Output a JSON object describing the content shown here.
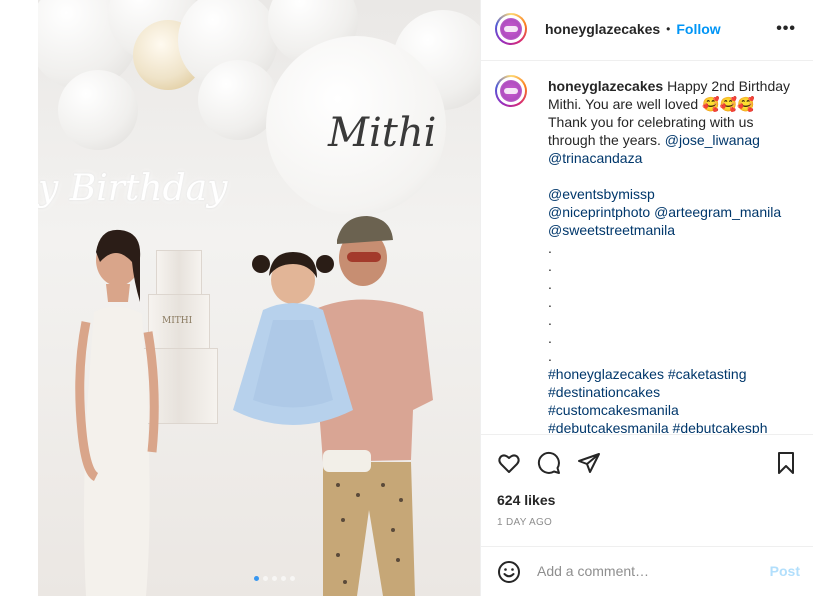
{
  "post": {
    "username": "honeyglazecakes",
    "separator": "•",
    "follow_label": "Follow",
    "more_label": "•••",
    "caption": {
      "username": "honeyglazecakes",
      "line1_text": "Happy 2nd Birthday",
      "line2_text": "Mithi. You are well loved 🥰🥰🥰",
      "line3_text": "Thank you for celebrating with us",
      "line4_text": "through the years.",
      "mention_jose": "@jose_liwanag",
      "mention_trina": "@trinacandaza",
      "mention_events": "@eventsbymissp",
      "mention_niceprint": "@niceprintphoto",
      "mention_arteegram": "@arteegram_manila",
      "mention_sweetstreet": "@sweetstreetmanila",
      "dots": [
        ".",
        ".",
        ".",
        ".",
        ".",
        ".",
        "."
      ],
      "tag_honeyglaze": "#honeyglazecakes",
      "tag_caketasting": "#caketasting",
      "tag_destination": "#destinationcakes",
      "tag_custom": "#customcakesmanila",
      "tag_debut_manila": "#debutcakesmanila",
      "tag_debut_ph": "#debutcakesph"
    },
    "likes": "624 likes",
    "timestamp": "1 DAY AGO",
    "comment_placeholder": "Add a comment…",
    "post_label": "Post"
  },
  "media": {
    "neon_sign": "y Birthday",
    "name_sign": "Mithi",
    "cake_label": "MITHI",
    "next_arrow": "›",
    "carousel_count": 5,
    "carousel_active": 1
  },
  "icons": {
    "like": "heart-icon",
    "comment": "comment-icon",
    "share": "share-icon",
    "save": "bookmark-icon",
    "emoji": "smiley-icon"
  },
  "colors": {
    "link": "#00376b",
    "follow": "#0095f6",
    "post_disabled": "#b2dffc",
    "muted": "#8e8e8e"
  }
}
